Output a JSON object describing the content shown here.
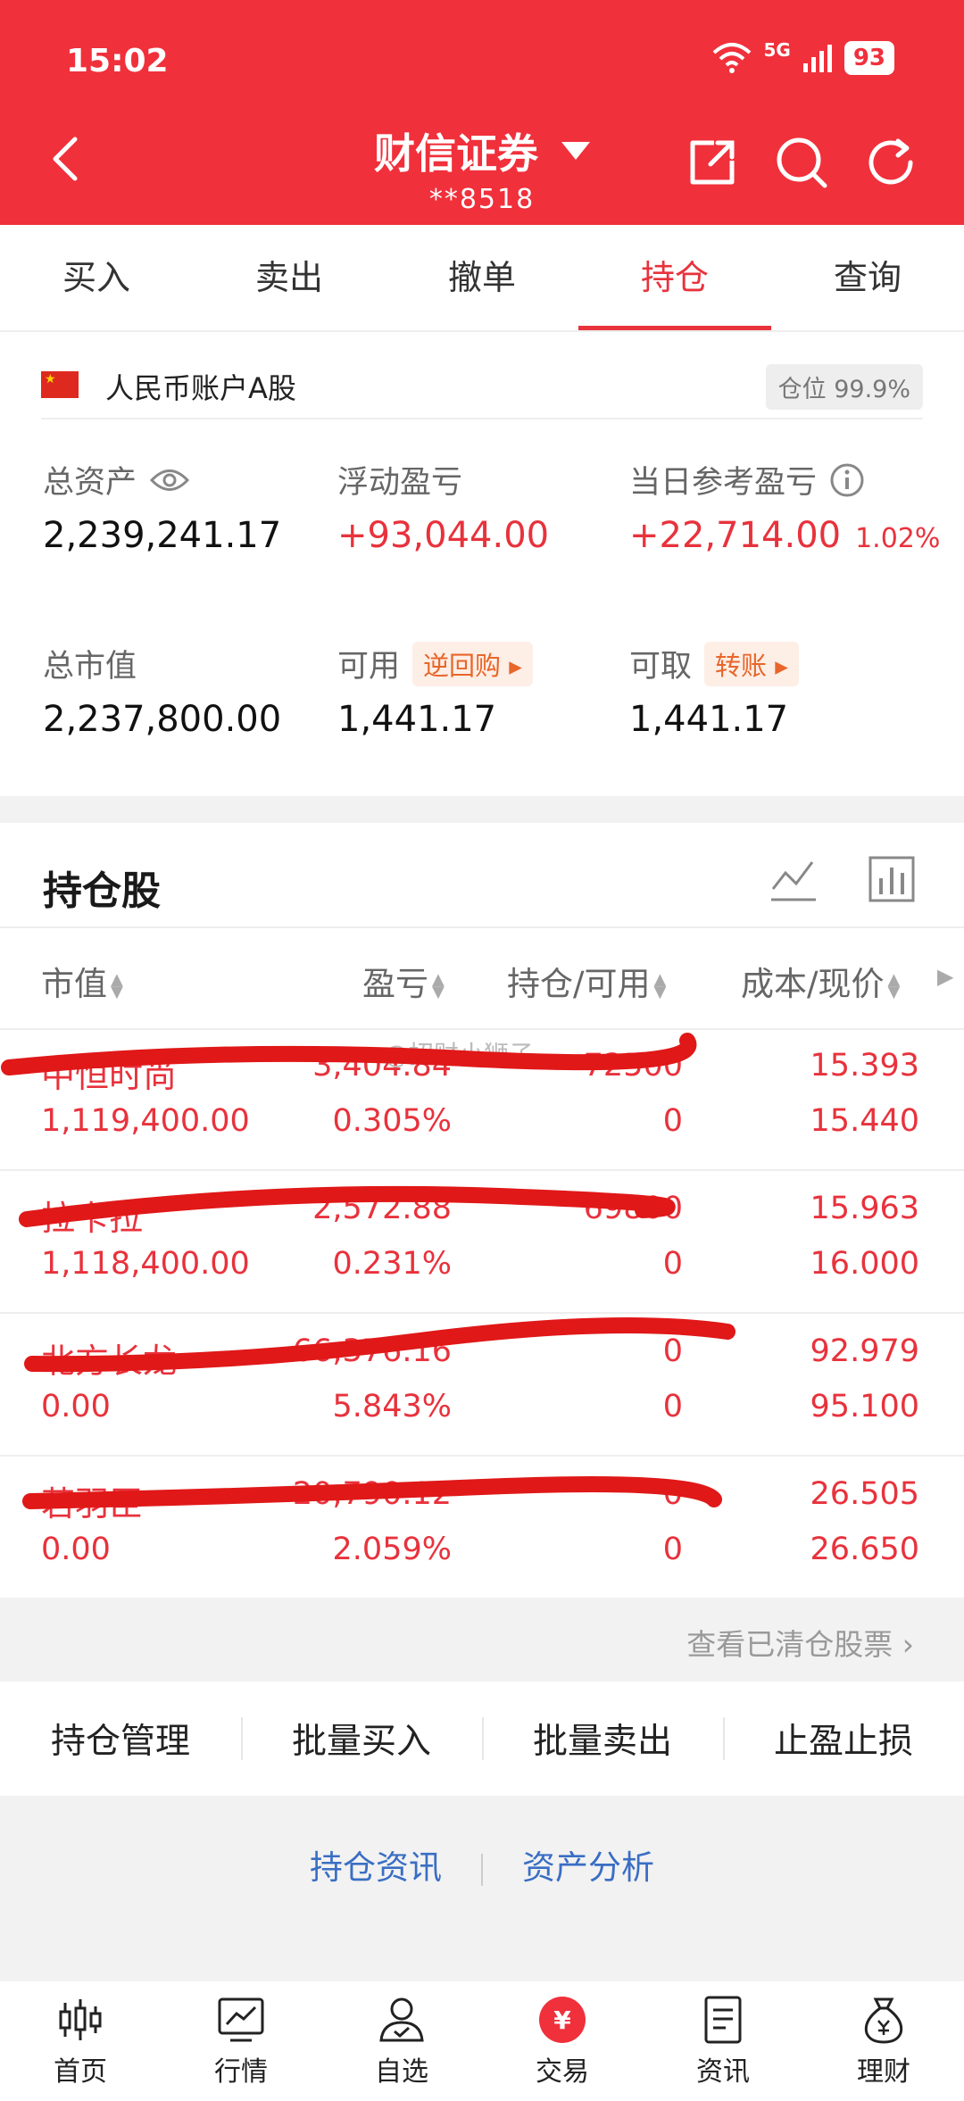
{
  "status": {
    "time": "15:02",
    "network": "5G",
    "battery": "93"
  },
  "header": {
    "title": "财信证券",
    "account": "**8518"
  },
  "tabs": [
    {
      "label": "买入",
      "active": false
    },
    {
      "label": "卖出",
      "active": false
    },
    {
      "label": "撤单",
      "active": false
    },
    {
      "label": "持仓",
      "active": true
    },
    {
      "label": "查询",
      "active": false
    }
  ],
  "account": {
    "label": "人民币账户A股",
    "position_ratio": "仓位 99.9%"
  },
  "metrics": {
    "total_assets_label": "总资产",
    "total_assets": "2,239,241.17",
    "floating_pl_label": "浮动盈亏",
    "floating_pl": "+93,044.00",
    "daily_pl_label": "当日参考盈亏",
    "daily_pl": "+22,714.00",
    "daily_pl_pct": "1.02%",
    "market_value_label": "总市值",
    "market_value": "2,237,800.00",
    "available_label": "可用",
    "available_tag": "逆回购",
    "available": "1,441.17",
    "withdrawable_label": "可取",
    "withdrawable_tag": "转账",
    "withdrawable": "1,441.17"
  },
  "holdings": {
    "title": "持仓股",
    "columns": [
      "市值",
      "盈亏",
      "持仓/可用",
      "成本/现价"
    ],
    "watermark": "@招财小狮子",
    "rows": [
      {
        "name": "中恒时尚",
        "pl": "3,404.84",
        "position": "72500",
        "cost": "15.393",
        "market_value": "1,119,400.00",
        "pl_pct": "0.305%",
        "available": "0",
        "price": "15.440"
      },
      {
        "name": "拉卡拉",
        "pl": "2,572.88",
        "position": "69800",
        "cost": "15.963",
        "market_value": "1,118,400.00",
        "pl_pct": "0.231%",
        "available": "0",
        "price": "16.000"
      },
      {
        "name": "北方长龙",
        "pl": "66,376.16",
        "position": "0",
        "cost": "92.979",
        "market_value": "0.00",
        "pl_pct": "5.843%",
        "available": "0",
        "price": "95.100"
      },
      {
        "name": "若羽臣",
        "pl": "20,790.12",
        "position": "0",
        "cost": "26.505",
        "market_value": "0.00",
        "pl_pct": "2.059%",
        "available": "0",
        "price": "26.650"
      }
    ]
  },
  "cleared_link": "查看已清仓股票",
  "actions": [
    "持仓管理",
    "批量买入",
    "批量卖出",
    "止盈止损"
  ],
  "links": [
    "持仓资讯",
    "资产分析"
  ],
  "bottom_nav": [
    {
      "label": "首页",
      "icon": "candlestick-icon"
    },
    {
      "label": "行情",
      "icon": "market-chart-icon"
    },
    {
      "label": "自选",
      "icon": "user-check-icon"
    },
    {
      "label": "交易",
      "icon": "yuan-icon"
    },
    {
      "label": "资讯",
      "icon": "document-icon"
    },
    {
      "label": "理财",
      "icon": "money-bag-icon"
    }
  ],
  "colors": {
    "brand_red": "#f0303b",
    "gain_red": "#e8323c",
    "orange": "#e8662a",
    "link_blue": "#3a6ec4"
  }
}
